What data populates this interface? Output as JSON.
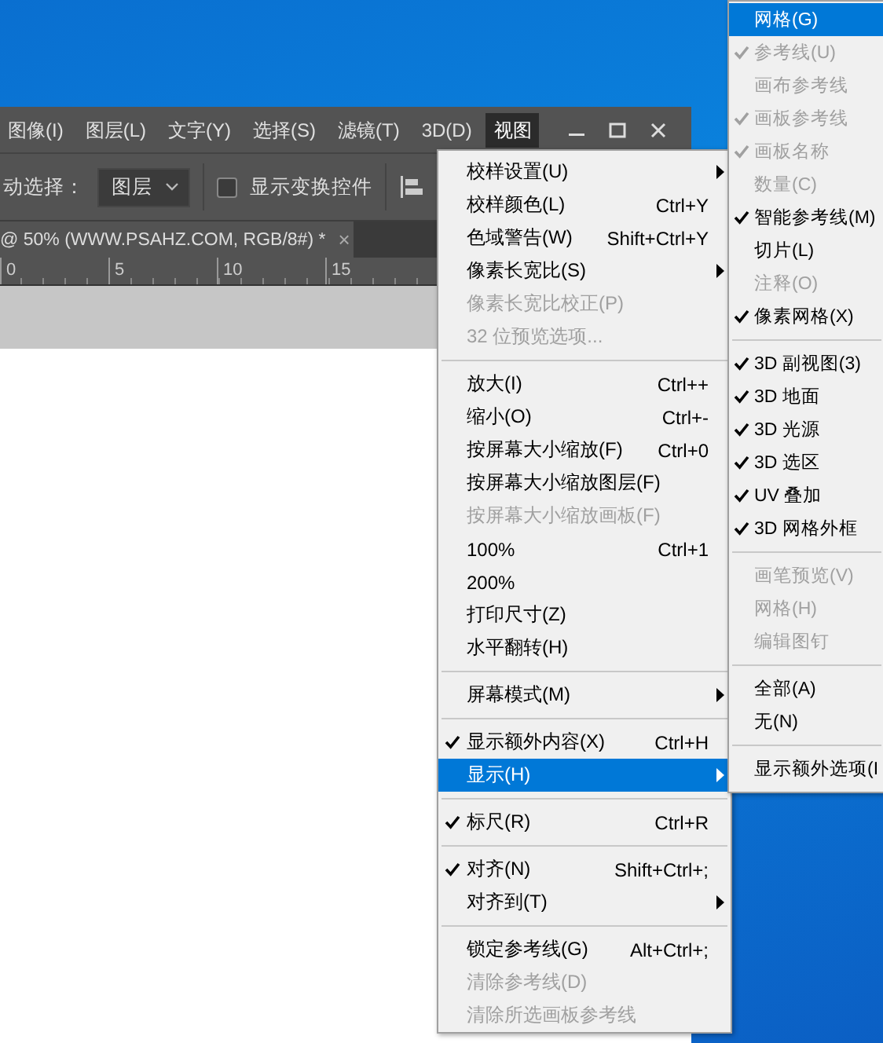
{
  "menu_bar": {
    "items": [
      {
        "label": "图像(I)",
        "selected": false
      },
      {
        "label": "图层(L)",
        "selected": false
      },
      {
        "label": "文字(Y)",
        "selected": false
      },
      {
        "label": "选择(S)",
        "selected": false
      },
      {
        "label": "滤镜(T)",
        "selected": false
      },
      {
        "label": "3D(D)",
        "selected": false
      },
      {
        "label": "视图",
        "selected": true
      }
    ]
  },
  "options_bar": {
    "label": "动选择：",
    "dropdown": "图层",
    "checkbox": {
      "label": "显示变换控件",
      "checked": false
    }
  },
  "document_tab": {
    "title": "@ 50% (WWW.PSAHZ.COM, RGB/8#) *",
    "close": "×"
  },
  "ruler": {
    "labels": [
      "0",
      "5",
      "10",
      "15"
    ]
  },
  "view_menu": {
    "items": [
      {
        "kind": "item",
        "label": "校样设置(U)",
        "submenu": true,
        "checked": false,
        "disabled": false,
        "selected": false
      },
      {
        "kind": "item",
        "label": "校样颜色(L)",
        "shortcut": "Ctrl+Y",
        "submenu": false,
        "checked": false,
        "disabled": false,
        "selected": false
      },
      {
        "kind": "item",
        "label": "色域警告(W)",
        "shortcut": "Shift+Ctrl+Y",
        "submenu": false,
        "checked": false,
        "disabled": false,
        "selected": false
      },
      {
        "kind": "item",
        "label": "像素长宽比(S)",
        "submenu": true,
        "checked": false,
        "disabled": false,
        "selected": false
      },
      {
        "kind": "item",
        "label": "像素长宽比校正(P)",
        "submenu": false,
        "checked": false,
        "disabled": true,
        "selected": false
      },
      {
        "kind": "item",
        "label": "32 位预览选项...",
        "submenu": false,
        "checked": false,
        "disabled": true,
        "selected": false
      },
      {
        "kind": "separator"
      },
      {
        "kind": "item",
        "label": "放大(I)",
        "shortcut": "Ctrl++",
        "submenu": false,
        "checked": false,
        "disabled": false,
        "selected": false
      },
      {
        "kind": "item",
        "label": "缩小(O)",
        "shortcut": "Ctrl+-",
        "submenu": false,
        "checked": false,
        "disabled": false,
        "selected": false
      },
      {
        "kind": "item",
        "label": "按屏幕大小缩放(F)",
        "shortcut": "Ctrl+0",
        "submenu": false,
        "checked": false,
        "disabled": false,
        "selected": false
      },
      {
        "kind": "item",
        "label": "按屏幕大小缩放图层(F)",
        "submenu": false,
        "checked": false,
        "disabled": false,
        "selected": false
      },
      {
        "kind": "item",
        "label": "按屏幕大小缩放画板(F)",
        "submenu": false,
        "checked": false,
        "disabled": true,
        "selected": false
      },
      {
        "kind": "item",
        "label": "100%",
        "shortcut": "Ctrl+1",
        "submenu": false,
        "checked": false,
        "disabled": false,
        "selected": false
      },
      {
        "kind": "item",
        "label": "200%",
        "submenu": false,
        "checked": false,
        "disabled": false,
        "selected": false
      },
      {
        "kind": "item",
        "label": "打印尺寸(Z)",
        "submenu": false,
        "checked": false,
        "disabled": false,
        "selected": false
      },
      {
        "kind": "item",
        "label": "水平翻转(H)",
        "submenu": false,
        "checked": false,
        "disabled": false,
        "selected": false
      },
      {
        "kind": "separator"
      },
      {
        "kind": "item",
        "label": "屏幕模式(M)",
        "submenu": true,
        "checked": false,
        "disabled": false,
        "selected": false
      },
      {
        "kind": "separator"
      },
      {
        "kind": "item",
        "label": "显示额外内容(X)",
        "shortcut": "Ctrl+H",
        "submenu": false,
        "checked": true,
        "disabled": false,
        "selected": false
      },
      {
        "kind": "item",
        "label": "显示(H)",
        "submenu": true,
        "checked": false,
        "disabled": false,
        "selected": true
      },
      {
        "kind": "separator"
      },
      {
        "kind": "item",
        "label": "标尺(R)",
        "shortcut": "Ctrl+R",
        "submenu": false,
        "checked": true,
        "disabled": false,
        "selected": false
      },
      {
        "kind": "separator"
      },
      {
        "kind": "item",
        "label": "对齐(N)",
        "shortcut": "Shift+Ctrl+;",
        "submenu": false,
        "checked": true,
        "disabled": false,
        "selected": false
      },
      {
        "kind": "item",
        "label": "对齐到(T)",
        "submenu": true,
        "checked": false,
        "disabled": false,
        "selected": false
      },
      {
        "kind": "separator"
      },
      {
        "kind": "item",
        "label": "锁定参考线(G)",
        "shortcut": "Alt+Ctrl+;",
        "submenu": false,
        "checked": false,
        "disabled": false,
        "selected": false
      },
      {
        "kind": "item",
        "label": "清除参考线(D)",
        "submenu": false,
        "checked": false,
        "disabled": true,
        "selected": false
      },
      {
        "kind": "item",
        "label": "清除所选画板参考线",
        "submenu": false,
        "checked": false,
        "disabled": true,
        "selected": false
      }
    ]
  },
  "show_submenu": {
    "items": [
      {
        "kind": "item",
        "label": "网格(G)",
        "checked": false,
        "disabled": false,
        "selected": true
      },
      {
        "kind": "item",
        "label": "参考线(U)",
        "checked": true,
        "disabled": true,
        "selected": false
      },
      {
        "kind": "item",
        "label": "画布参考线",
        "checked": false,
        "disabled": true,
        "selected": false
      },
      {
        "kind": "item",
        "label": "画板参考线",
        "checked": true,
        "disabled": true,
        "selected": false
      },
      {
        "kind": "item",
        "label": "画板名称",
        "checked": true,
        "disabled": true,
        "selected": false
      },
      {
        "kind": "item",
        "label": "数量(C)",
        "checked": false,
        "disabled": true,
        "selected": false
      },
      {
        "kind": "item",
        "label": "智能参考线(M)",
        "checked": true,
        "disabled": false,
        "selected": false
      },
      {
        "kind": "item",
        "label": "切片(L)",
        "checked": false,
        "disabled": false,
        "selected": false
      },
      {
        "kind": "item",
        "label": "注释(O)",
        "checked": false,
        "disabled": true,
        "selected": false
      },
      {
        "kind": "item",
        "label": "像素网格(X)",
        "checked": true,
        "disabled": false,
        "selected": false
      },
      {
        "kind": "separator"
      },
      {
        "kind": "item",
        "label": "3D 副视图(3)",
        "checked": true,
        "disabled": false,
        "selected": false
      },
      {
        "kind": "item",
        "label": "3D 地面",
        "checked": true,
        "disabled": false,
        "selected": false
      },
      {
        "kind": "item",
        "label": "3D 光源",
        "checked": true,
        "disabled": false,
        "selected": false
      },
      {
        "kind": "item",
        "label": "3D 选区",
        "checked": true,
        "disabled": false,
        "selected": false
      },
      {
        "kind": "item",
        "label": "UV 叠加",
        "checked": true,
        "disabled": false,
        "selected": false
      },
      {
        "kind": "item",
        "label": "3D 网格外框",
        "checked": true,
        "disabled": false,
        "selected": false
      },
      {
        "kind": "separator"
      },
      {
        "kind": "item",
        "label": "画笔预览(V)",
        "checked": false,
        "disabled": true,
        "selected": false
      },
      {
        "kind": "item",
        "label": "网格(H)",
        "checked": false,
        "disabled": true,
        "selected": false
      },
      {
        "kind": "item",
        "label": "编辑图钉",
        "checked": false,
        "disabled": true,
        "selected": false
      },
      {
        "kind": "separator"
      },
      {
        "kind": "item",
        "label": "全部(A)",
        "checked": false,
        "disabled": false,
        "selected": false
      },
      {
        "kind": "item",
        "label": "无(N)",
        "checked": false,
        "disabled": false,
        "selected": false
      },
      {
        "kind": "separator"
      },
      {
        "kind": "item",
        "label": "显示额外选项(I",
        "checked": false,
        "disabled": false,
        "selected": false
      }
    ]
  }
}
